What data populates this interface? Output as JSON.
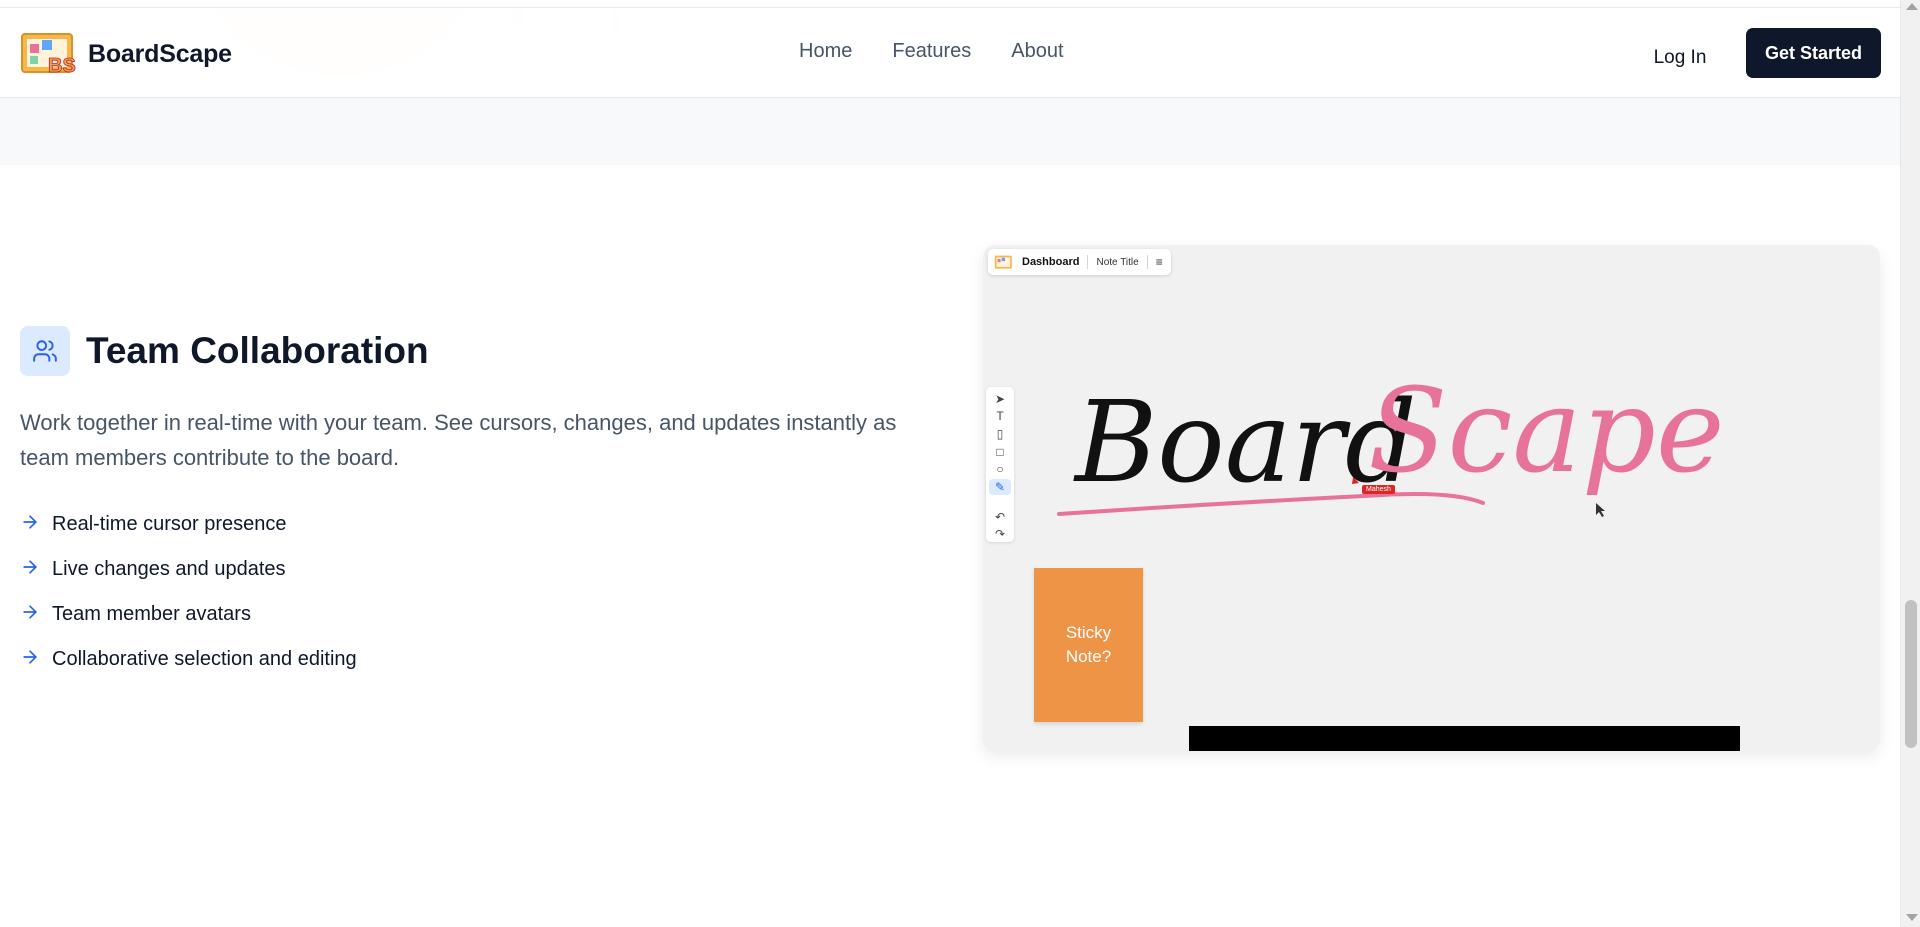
{
  "brand": {
    "name": "BoardScape",
    "logo_text": "BS"
  },
  "nav": {
    "links": [
      {
        "label": "Home"
      },
      {
        "label": "Features"
      },
      {
        "label": "About"
      }
    ],
    "login_label": "Log In",
    "cta_label": "Get Started"
  },
  "feature": {
    "icon": "users-icon",
    "title": "Team Collaboration",
    "description": "Work together in real-time with your team. See cursors, changes, and updates instantly as team members contribute to the board.",
    "bullets": [
      "Real-time cursor presence",
      "Live changes and updates",
      "Team member avatars",
      "Collaborative selection and editing"
    ]
  },
  "preview": {
    "dashboard_label": "Dashboard",
    "note_title": "Note Title",
    "menu_icon": "hamburger-icon",
    "tools": [
      "pointer-icon",
      "text-icon",
      "note-icon",
      "rectangle-icon",
      "circle-icon",
      "pen-icon",
      "undo-icon",
      "redo-icon"
    ],
    "sticky_text_line1": "Sticky",
    "sticky_text_line2": "Note?",
    "cursor_user": "Mahesh",
    "handwriting_black": "Board",
    "handwriting_pink": "Scape",
    "colors": {
      "black_ink": "#111111",
      "pink_ink": "#e8739a",
      "sticky": "#ee9447"
    }
  },
  "colors": {
    "primary_dark": "#0f172a",
    "accent_blue": "#2563eb",
    "icon_bg": "#dbeafe"
  }
}
